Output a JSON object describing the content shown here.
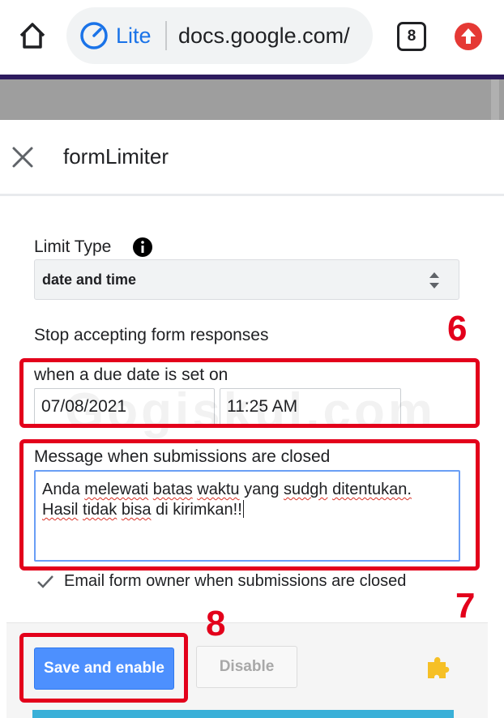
{
  "browser": {
    "lite_label": "Lite",
    "url": "docs.google.com/",
    "tab_count": "8",
    "icons": {
      "home": "home-icon",
      "lite": "speedometer-icon",
      "update": "arrow-up-circle-icon"
    },
    "accent_color": "#1a73e8",
    "update_color": "#e53935"
  },
  "panel": {
    "title": "formLimiter",
    "limit_type_label": "Limit Type",
    "limit_type_value": "date and time",
    "stop_label": "Stop accepting form responses",
    "due_label": "when a due date is set on",
    "date_value": "07/08/2021",
    "time_value": "11:25 AM",
    "message_label": "Message when submissions are closed",
    "message_line1_a": "Anda",
    "message_line1_b": "melewati",
    "message_line1_c": "batas",
    "message_line1_d": "waktu",
    "message_line1_e": "yang",
    "message_line1_f": "sudgh",
    "message_line1_g": "ditentukan.",
    "message_line2_a": "Hasil",
    "message_line2_b": "tidak",
    "message_line2_c": "bisa",
    "message_line2_d": "di kirimkan!!",
    "email_label": "Email form owner when submissions are closed",
    "email_checked": true
  },
  "footer": {
    "save_label": "Save and enable",
    "disable_label": "Disable",
    "primary_color": "#4d90fe"
  },
  "annotations": {
    "step6": "6",
    "step7": "7",
    "step8": "8",
    "highlight_color": "#e3001b",
    "watermark": "Gogiskul.com"
  }
}
